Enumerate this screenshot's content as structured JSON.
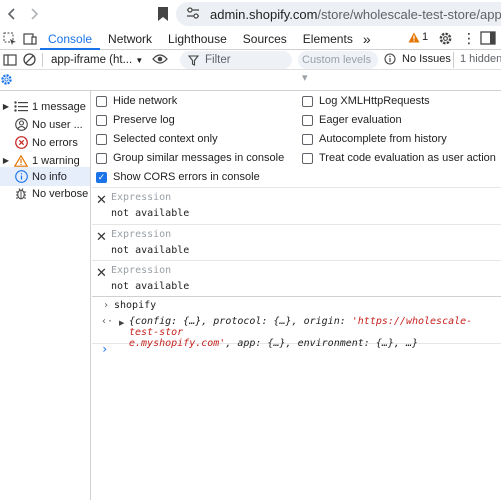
{
  "browser": {
    "url_host": "admin.shopify.com",
    "url_path": "/store/wholescale-test-store/apps/review-h"
  },
  "devtools": {
    "tabs": [
      "Console",
      "Network",
      "Lighthouse",
      "Sources",
      "Elements"
    ],
    "more_tabs": "»",
    "warning_count": "1",
    "accent_color": "#1a73e8"
  },
  "toolbar": {
    "context": "app-iframe (ht...",
    "filter_placeholder": "Filter",
    "levels_label": "Custom levels ▾",
    "issues_label": "No Issues",
    "hidden_label": "1 hidden"
  },
  "sidebar": {
    "items": [
      {
        "label": "1 message",
        "icon": "list-icon"
      },
      {
        "label": "No user ...",
        "icon": "user-icon"
      },
      {
        "label": "No errors",
        "icon": "error-icon"
      },
      {
        "label": "1 warning",
        "icon": "warning-icon"
      },
      {
        "label": "No info",
        "icon": "info-icon"
      },
      {
        "label": "No verbose",
        "icon": "bug-icon"
      }
    ]
  },
  "settings": {
    "left": [
      {
        "label": "Hide network",
        "checked": false
      },
      {
        "label": "Preserve log",
        "checked": false
      },
      {
        "label": "Selected context only",
        "checked": false
      },
      {
        "label": "Group similar messages in console",
        "checked": false
      },
      {
        "label": "Show CORS errors in console",
        "checked": true
      }
    ],
    "right": [
      {
        "label": "Log XMLHttpRequests",
        "checked": false
      },
      {
        "label": "Eager evaluation",
        "checked": false
      },
      {
        "label": "Autocomplete from history",
        "checked": false
      },
      {
        "label": "Treat code evaluation as user action",
        "checked": false
      }
    ]
  },
  "live_expressions": [
    {
      "name": "Expression",
      "value": "not available"
    },
    {
      "name": "Expression",
      "value": "not available"
    },
    {
      "name": "Expression",
      "value": "not available"
    }
  ],
  "console": {
    "input": "shopify",
    "output_line1_a": "{config: {…}, protocol: {…}, origin: ",
    "output_origin_a": "'https://wholescale-test-stor",
    "output_origin_b": "e.myshopify.com'",
    "output_line2_b": ", app: {…}, environment: {…}, …}"
  }
}
